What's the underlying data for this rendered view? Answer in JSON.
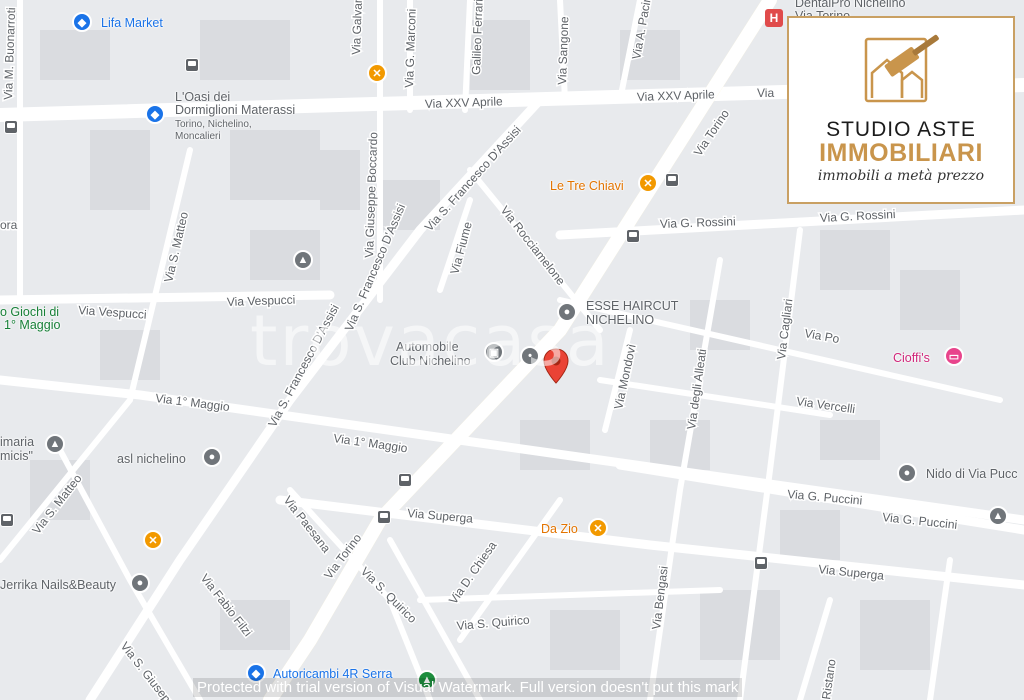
{
  "streets": {
    "xxv_aprile_1": "Via XXV Aprile",
    "xxv_aprile_2": "Via XXV Aprile",
    "torino_1": "Via Torino",
    "torino_2": "Via Torino",
    "rossini_1": "Via G. Rossini",
    "rossini_2": "Via G. Rossini",
    "francesco_assisi_1": "Via S. Francesco D'Assisi",
    "francesco_assisi_2": "Via S. Francesco D'Assisi",
    "francesco_assisi_3": "Via S. Francesco D'Assisi",
    "vespucci_1": "Via Vespucci",
    "vespucci_2": "Via Vespucci",
    "primo_maggio_1": "Via 1° Maggio",
    "primo_maggio_2": "Via 1° Maggio",
    "superga_1": "Via Superga",
    "superga_2": "Via Superga",
    "puccini_1": "Via G. Puccini",
    "puccini_2": "Via G. Puccini",
    "rocciamelone": "Via Rocciamelone",
    "fiume": "Via Fiume",
    "mondovi": "Via Mondovì",
    "alleati": "Via degli Alleati",
    "cagliari": "Via Cagliari",
    "po": "Via Po",
    "vercelli": "Via Vercelli",
    "s_matteo_1": "Via S. Matteo",
    "s_matteo_2": "Via S. Matteo",
    "boccardo": "Via Giuseppe Boccardo",
    "marconi": "Via G. Marconi",
    "galvani": "Via Galvani",
    "ferraris": "Galileo Ferraris",
    "sangone": "Via Sangone",
    "pacinotti": "Via A. Pacinotti",
    "buonarroti": "Via M. Buonarroti",
    "paesana": "Via Paesana",
    "quirico_1": "Via S. Quirico",
    "quirico_2": "Via S. Quirico",
    "chiesa": "Via D. Chiesa",
    "bengasi": "Via Bengasi",
    "filzi": "Via Fabio Filzi",
    "s_giuseppe": "Via S. Giusepp",
    "ristano": "Ristano",
    "vic": "Via",
    "ora": "ora"
  },
  "places": {
    "lifa_market": "Lifa Market",
    "oasi_line1": "L'Oasi dei",
    "oasi_line2": "Dormiglioni Materassi",
    "oasi_line3": "Torino, Nichelino,",
    "oasi_line4": "Moncalieri",
    "dentalpro_line1": "DentalPro Nichelino",
    "dentalpro_line2": "Via Torino",
    "le_tre_chiavi": "Le Tre Chiavi",
    "esse_line1": "ESSE HAIRCUT",
    "esse_line2": "NICHELINO",
    "automobile_line1": "Automobile",
    "automobile_line2": "Club Nichelino",
    "cioffis": "Cioffi's",
    "giochi_line1": "o Giochi di",
    "giochi_line2": "1° Maggio",
    "primaria_line1": "imaria",
    "primaria_line2": "micis\"",
    "asl": "asl nichelino",
    "nido": "Nido di Via Pucc",
    "da_zio": "Da Zio",
    "nails": "Jerrika Nails&Beauty",
    "autoricambi": "Autoricambi 4R Serra"
  },
  "logo": {
    "line1": "STUDIO ASTE",
    "line2": "IMMOBILIARI",
    "line3": "immobili a metà prezzo",
    "gold": "#c9954c"
  },
  "watermark": "trovacasa",
  "notice": "Protected with trial version of Visual Watermark. Full version doesn't put this mark",
  "colors": {
    "background": "#e8eaed",
    "road": "#ffffff",
    "marker": "#ea4335"
  }
}
